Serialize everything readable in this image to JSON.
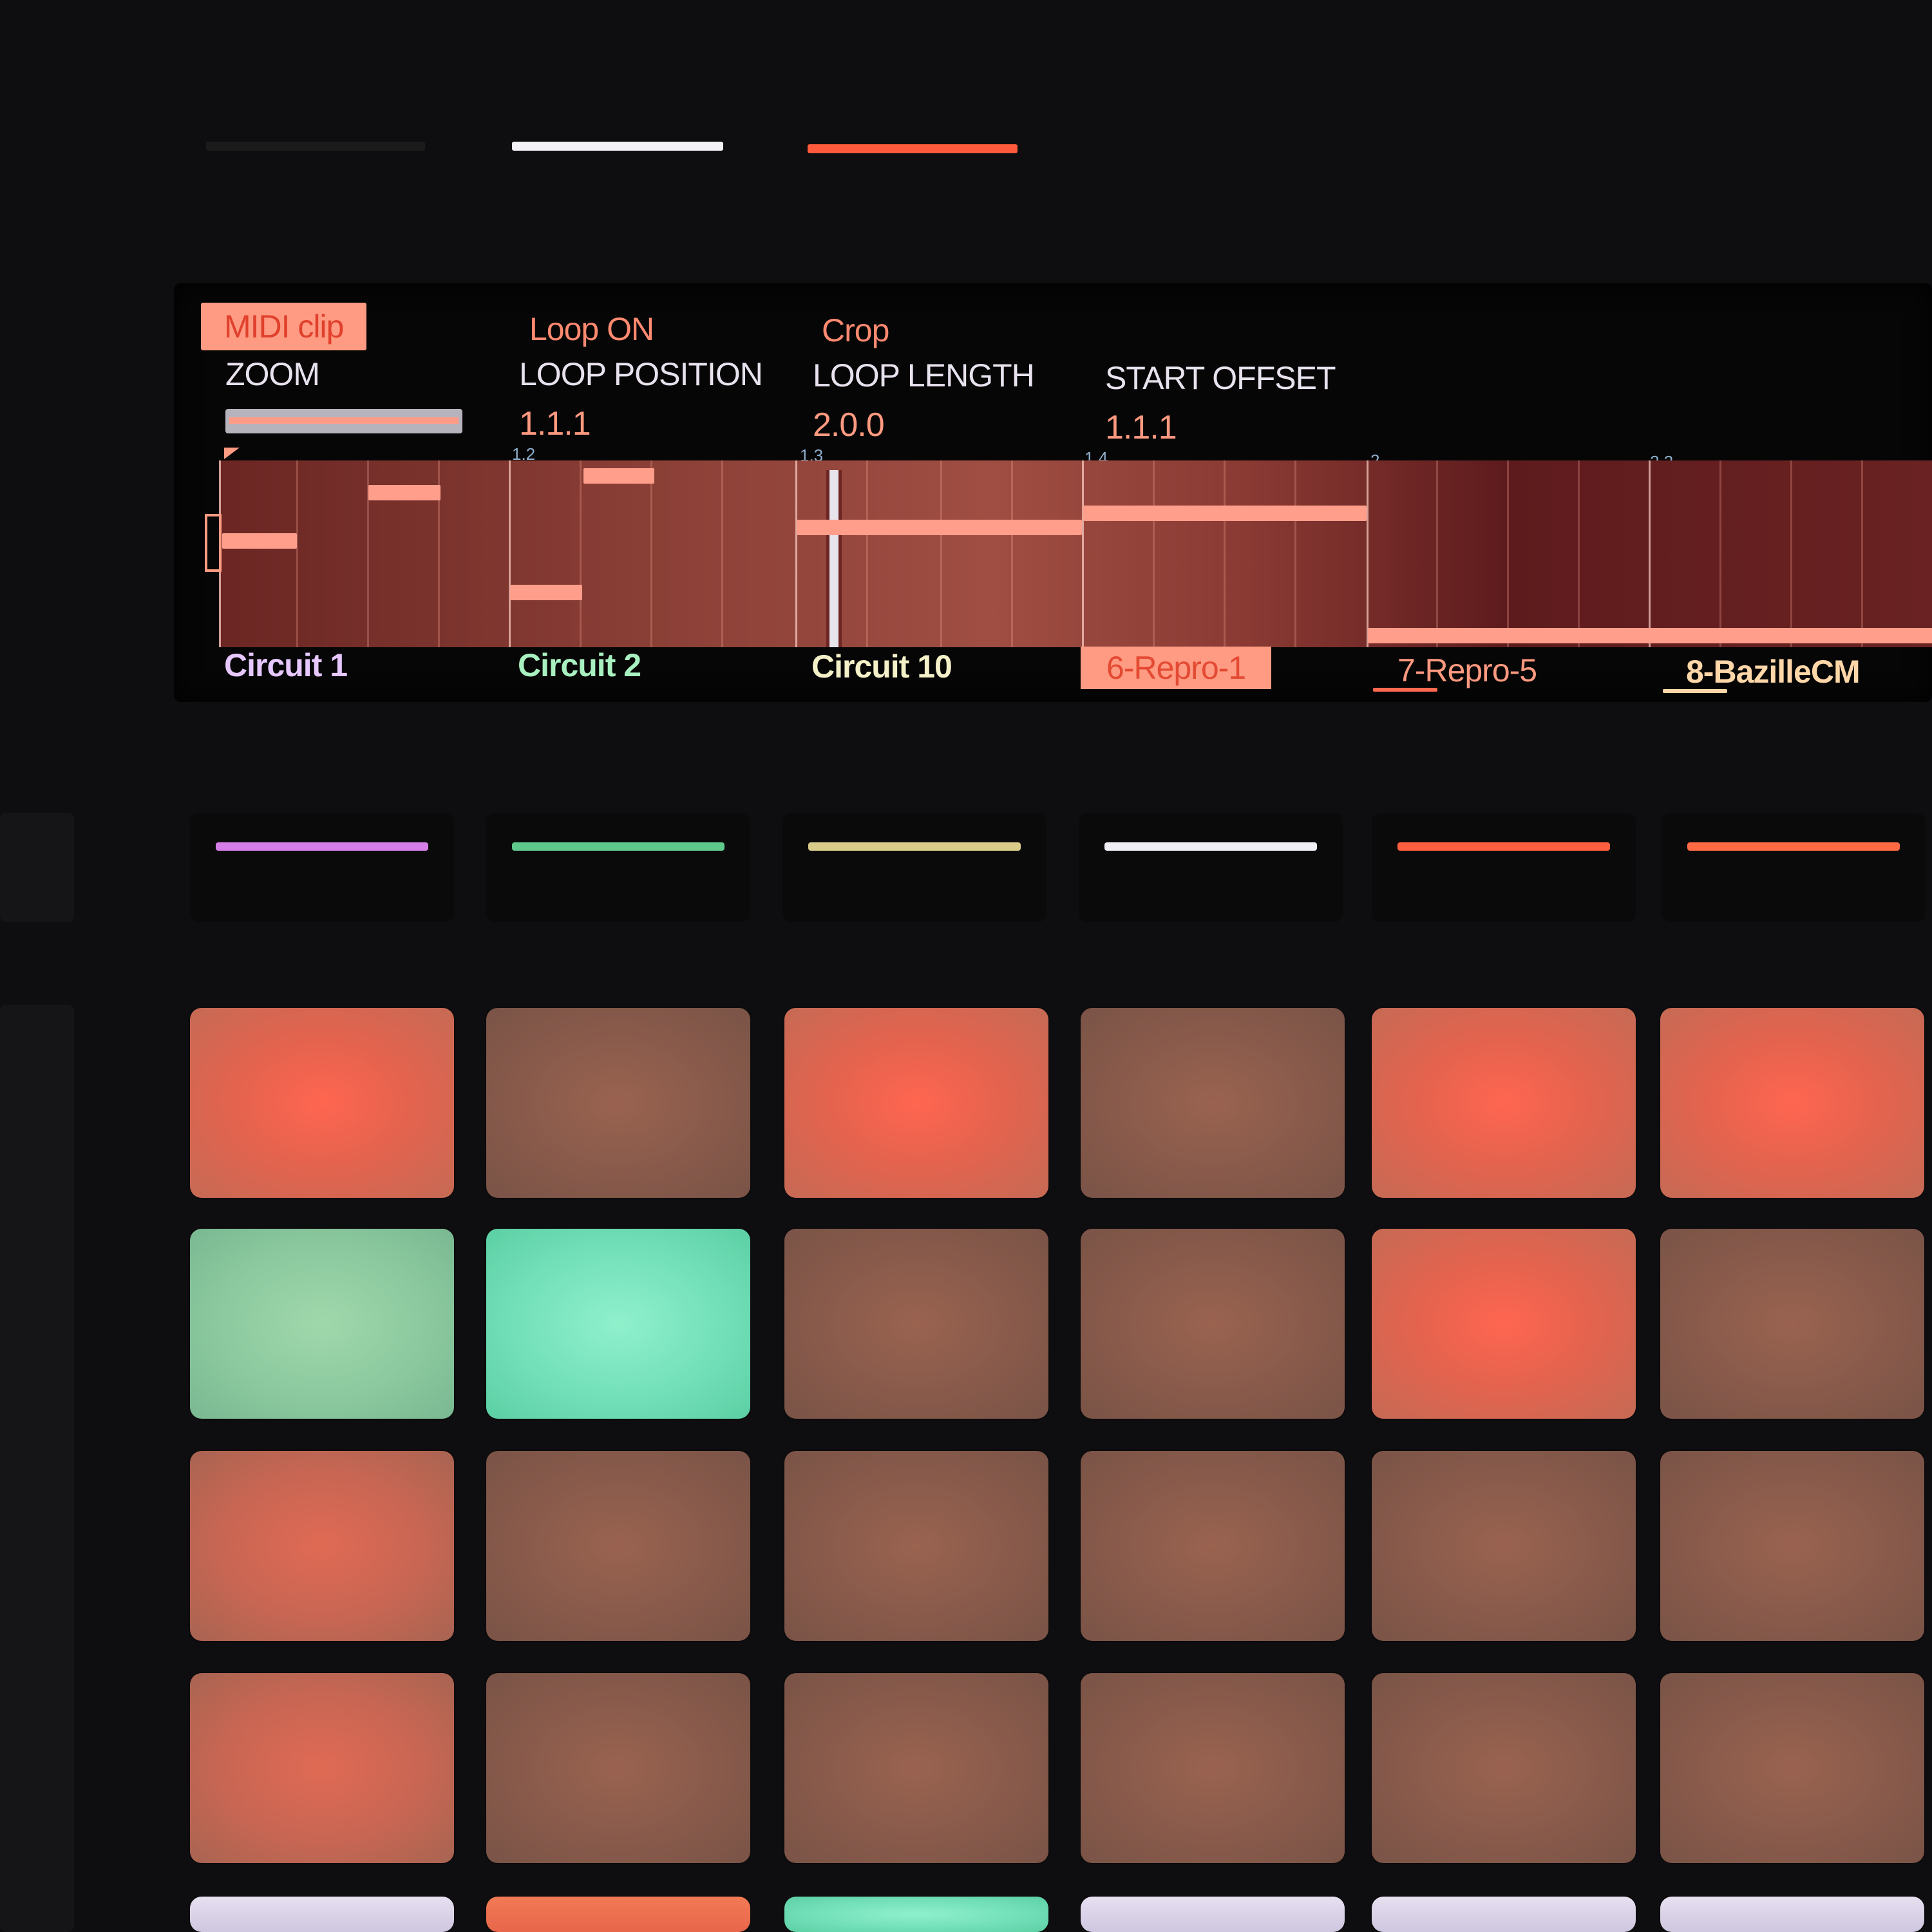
{
  "colors": {
    "background": "#0e0d0f",
    "accent": "#ff9b82",
    "pad_bright": "#f0654f",
    "pad_dim": "#8a5a48",
    "pad_green": "#6ed8b2",
    "pad_sage": "#8fcfa2",
    "pad_white": "#d9d2e6"
  },
  "top_buttons": [
    {
      "color": "#1c1b1c"
    },
    {
      "color": "#f4f1f6"
    },
    {
      "color": "#ff5a3c"
    }
  ],
  "display": {
    "function_labels": [
      "MIDI clip",
      "Loop ON",
      "Crop"
    ],
    "parameters": [
      {
        "name": "ZOOM",
        "value": ""
      },
      {
        "name": "LOOP POSITION",
        "value": "1.1.1"
      },
      {
        "name": "LOOP LENGTH",
        "value": "2.0.0"
      },
      {
        "name": "START OFFSET",
        "value": "1.1.1"
      }
    ],
    "ruler": [
      "1.2",
      "1.3",
      "1.4",
      "2",
      "2.2"
    ],
    "clip_notes": 9
  },
  "tracks": [
    {
      "name": "Circuit 1",
      "color": "#e6c8ff",
      "selected": false
    },
    {
      "name": "Circuit 2",
      "color": "#a8f0c0",
      "selected": false
    },
    {
      "name": "Circuit 10",
      "color": "#f4f0c8",
      "selected": false
    },
    {
      "name": "6-Repro-1",
      "color": "#ff9b82",
      "selected": true
    },
    {
      "name": "7-Repro-5",
      "color": "#ff9a80",
      "selected": false
    },
    {
      "name": "8-BazilleCM",
      "color": "#ffd7a8",
      "selected": false
    }
  ],
  "track_buttons": [
    {
      "color": "#d67ee8"
    },
    {
      "color": "#5fc98c"
    },
    {
      "color": "#d9cc8a"
    },
    {
      "color": "#f2eef6"
    },
    {
      "color": "#ff5f3e"
    },
    {
      "color": "#ff6a44"
    }
  ],
  "pad_grid": [
    [
      "bright",
      "dim",
      "bright",
      "dim",
      "bright",
      "bright"
    ],
    [
      "sage",
      "green",
      "dim",
      "dim",
      "bright",
      "dim"
    ],
    [
      "mid",
      "dim",
      "dim",
      "dim",
      "dim",
      "dim"
    ],
    [
      "mid",
      "dim",
      "dim",
      "dim",
      "dim",
      "dim"
    ],
    [
      "white",
      "orange",
      "green",
      "white",
      "white",
      "white"
    ]
  ]
}
